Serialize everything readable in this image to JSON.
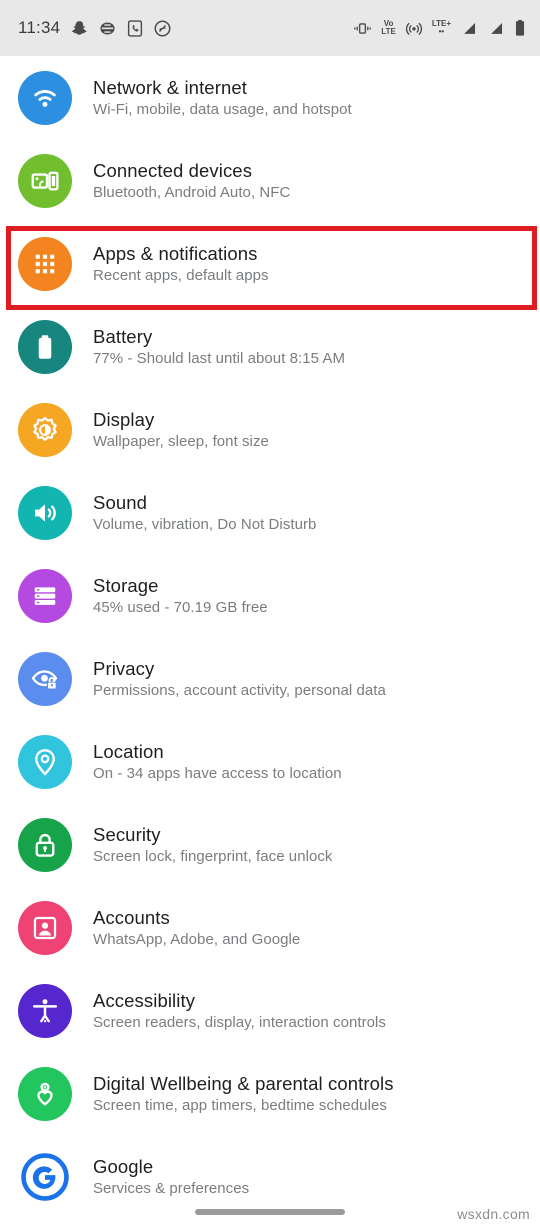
{
  "status_bar": {
    "time": "11:34",
    "left_icons": [
      "snapchat-icon",
      "browser-icon",
      "phone-call-icon",
      "shazam-icon"
    ],
    "right_icons": [
      "vibrate-icon",
      "volte-icon",
      "hotspot-icon",
      "lte-plus-icon",
      "signal-bars-1-icon",
      "signal-bars-2-icon",
      "battery-icon"
    ],
    "volte_label_top": "Vo",
    "volte_label_bottom": "LTE",
    "lte_label": "LTE+",
    "background_color": "#e8e8e8"
  },
  "settings": {
    "items": [
      {
        "title": "Network & internet",
        "subtitle": "Wi-Fi, mobile, data usage, and hotspot",
        "icon": "wifi-icon",
        "icon_color": "#2d8fe0",
        "highlighted": false
      },
      {
        "title": "Connected devices",
        "subtitle": "Bluetooth, Android Auto, NFC",
        "icon": "connected-devices-icon",
        "icon_color": "#71bf2e",
        "highlighted": false
      },
      {
        "title": "Apps & notifications",
        "subtitle": "Recent apps, default apps",
        "icon": "apps-grid-icon",
        "icon_color": "#f3841f",
        "highlighted": true
      },
      {
        "title": "Battery",
        "subtitle": "77% - Should last until about 8:15 AM",
        "icon": "battery-icon",
        "icon_color": "#16867f",
        "highlighted": false
      },
      {
        "title": "Display",
        "subtitle": "Wallpaper, sleep, font size",
        "icon": "brightness-icon",
        "icon_color": "#f5a623",
        "highlighted": false
      },
      {
        "title": "Sound",
        "subtitle": "Volume, vibration, Do Not Disturb",
        "icon": "speaker-icon",
        "icon_color": "#12b5b0",
        "highlighted": false
      },
      {
        "title": "Storage",
        "subtitle": "45% used - 70.19 GB free",
        "icon": "storage-icon",
        "icon_color": "#b44ae0",
        "highlighted": false
      },
      {
        "title": "Privacy",
        "subtitle": "Permissions, account activity, personal data",
        "icon": "privacy-eye-lock-icon",
        "icon_color": "#5b8def",
        "highlighted": false
      },
      {
        "title": "Location",
        "subtitle": "On - 34 apps have access to location",
        "icon": "location-pin-icon",
        "icon_color": "#31c4dd",
        "highlighted": false
      },
      {
        "title": "Security",
        "subtitle": "Screen lock, fingerprint, face unlock",
        "icon": "lock-icon",
        "icon_color": "#16a34a",
        "highlighted": false
      },
      {
        "title": "Accounts",
        "subtitle": "WhatsApp, Adobe, and Google",
        "icon": "account-person-icon",
        "icon_color": "#ef4374",
        "highlighted": false
      },
      {
        "title": "Accessibility",
        "subtitle": "Screen readers, display, interaction controls",
        "icon": "accessibility-icon",
        "icon_color": "#5626cf",
        "highlighted": false
      },
      {
        "title": "Digital Wellbeing & parental controls",
        "subtitle": "Screen time, app timers, bedtime schedules",
        "icon": "wellbeing-heart-icon",
        "icon_color": "#22c55e",
        "highlighted": false
      },
      {
        "title": "Google",
        "subtitle": "Services & preferences",
        "icon": "google-g-icon",
        "icon_color": "#ffffff",
        "highlighted": false
      }
    ]
  },
  "highlight": {
    "color": "#e01b22",
    "target": "Apps & notifications"
  },
  "nav_bar": {
    "gesture_pill": "home-gesture-pill"
  },
  "watermark": {
    "text": "wsxdn.com"
  }
}
